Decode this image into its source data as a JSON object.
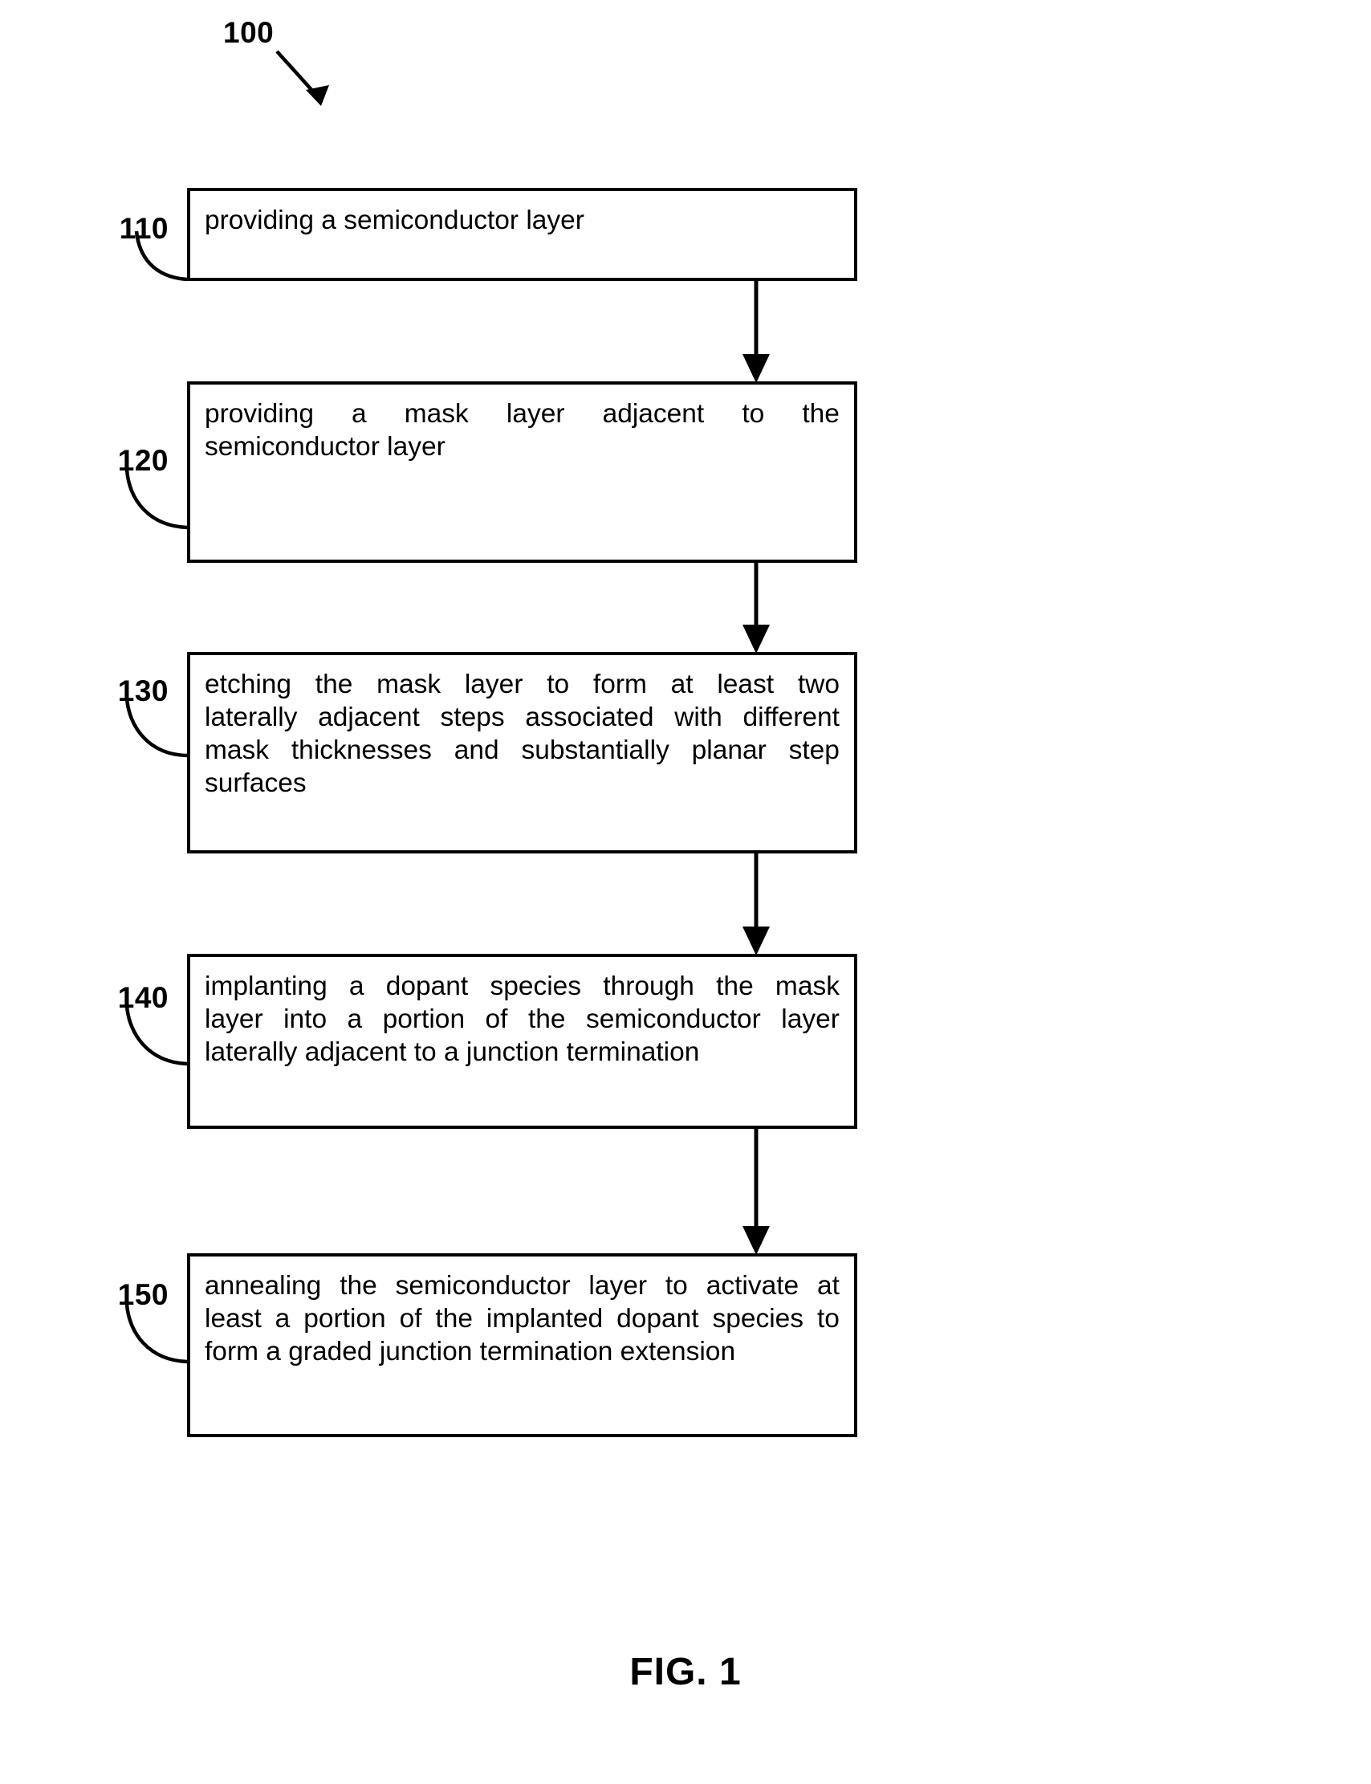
{
  "figure": {
    "number_label": "100",
    "caption": "FIG. 1"
  },
  "steps": [
    {
      "ref": "110",
      "lines": [
        {
          "text": "providing a semiconductor layer",
          "justify": false,
          "words": [
            "providing",
            "a",
            "semiconductor",
            "layer"
          ]
        }
      ],
      "text": "providing a semiconductor layer"
    },
    {
      "ref": "120",
      "lines": [
        {
          "text": "providing a mask layer adjacent to the",
          "justify": true,
          "words": [
            "providing",
            "a",
            "mask",
            "layer",
            "adjacent",
            "to",
            "the"
          ]
        },
        {
          "text": "semiconductor layer",
          "justify": false,
          "words": [
            "semiconductor",
            "layer"
          ]
        }
      ],
      "text": "providing a mask layer adjacent to the semiconductor layer"
    },
    {
      "ref": "130",
      "lines": [
        {
          "text": "etching the mask layer to form at least two",
          "justify": true,
          "words": [
            "etching",
            "the",
            "mask",
            "layer",
            "to",
            "form",
            "at",
            "least",
            "two"
          ]
        },
        {
          "text": "laterally adjacent steps associated with different",
          "justify": true,
          "words": [
            "laterally",
            "adjacent",
            "steps",
            "associated",
            "with",
            "different"
          ]
        },
        {
          "text": "mask thicknesses and substantially planar step",
          "justify": true,
          "words": [
            "mask",
            "thicknesses",
            "and",
            "substantially",
            "planar",
            "step"
          ]
        },
        {
          "text": "surfaces",
          "justify": false,
          "words": [
            "surfaces"
          ]
        }
      ],
      "text": "etching the mask layer to form at least two laterally adjacent steps associated with different mask thicknesses and substantially planar step surfaces"
    },
    {
      "ref": "140",
      "lines": [
        {
          "text": "implanting a dopant species through the mask",
          "justify": true,
          "words": [
            "implanting",
            "a",
            "dopant",
            "species",
            "through",
            "the",
            "mask"
          ]
        },
        {
          "text": "layer into a portion of the semiconductor layer",
          "justify": true,
          "words": [
            "layer",
            "into",
            "a",
            "portion",
            "of",
            "the",
            "semiconductor",
            "layer"
          ]
        },
        {
          "text": "laterally adjacent to a junction termination",
          "justify": false,
          "words": [
            "laterally",
            "adjacent",
            "to",
            "a",
            "junction",
            "termination"
          ]
        }
      ],
      "text": "implanting a dopant species through the mask layer into a portion of the semiconductor layer laterally adjacent to a junction termination"
    },
    {
      "ref": "150",
      "lines": [
        {
          "text": "annealing the semiconductor layer to activate at",
          "justify": true,
          "words": [
            "annealing",
            "the",
            "semiconductor",
            "layer",
            "to",
            "activate",
            "at"
          ]
        },
        {
          "text": "least a portion of the implanted dopant species to",
          "justify": true,
          "words": [
            "least",
            "a",
            "portion",
            "of",
            "the",
            "implanted",
            "dopant",
            "species",
            "to"
          ]
        },
        {
          "text": "form a graded junction termination extension",
          "justify": false,
          "words": [
            "form",
            "a",
            "graded",
            "junction",
            "termination",
            "extension"
          ]
        }
      ],
      "text": "annealing the semiconductor layer to activate at least a portion of the implanted dopant species to form a graded junction termination extension"
    }
  ],
  "colors": {
    "ink": "#000000",
    "paper": "#ffffff"
  }
}
